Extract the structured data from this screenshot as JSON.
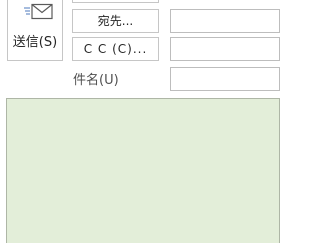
{
  "compose": {
    "send_label": "送信(S)",
    "to_button_label": "宛先...",
    "cc_button_label": "C C (C)...",
    "subject_label": "件名(U)",
    "to_value": "",
    "cc_value": "",
    "subject_value": "",
    "body_text": ""
  },
  "colors": {
    "body_background": "#e3eed9",
    "border": "#c6c6c6",
    "envelope_accent": "#6a8fc7"
  },
  "icons": {
    "send": "send-mail-icon"
  }
}
